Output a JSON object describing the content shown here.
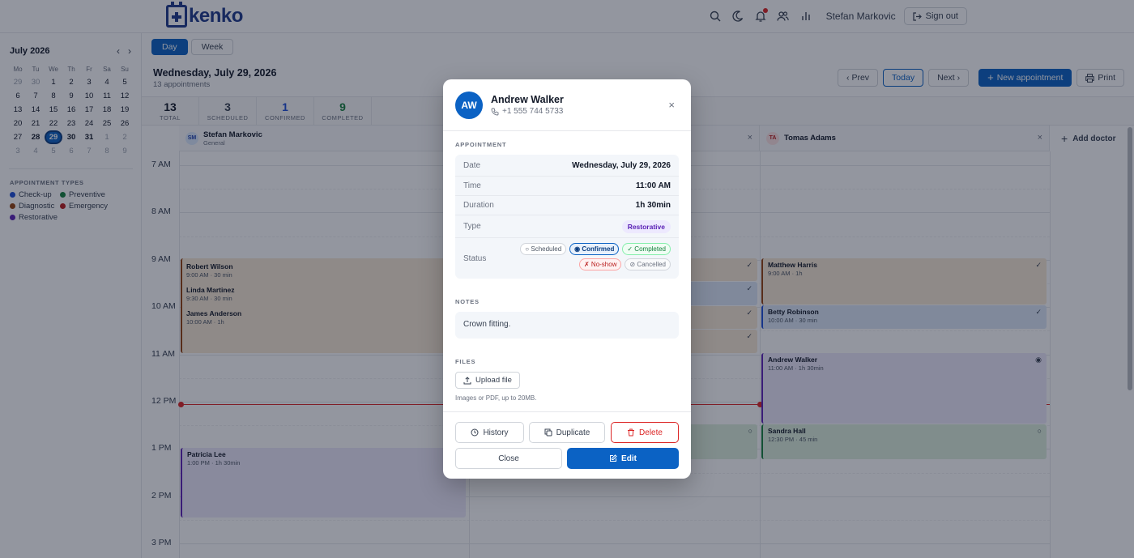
{
  "header": {
    "logo_text": "kenko",
    "user_name": "Stefan Markovic",
    "sign_out_label": "Sign out",
    "icons": [
      "search-icon",
      "moon-icon",
      "bell-icon",
      "users-icon",
      "chart-icon"
    ]
  },
  "sidebar": {
    "month_label": "July 2026",
    "weekdays": [
      "Mo",
      "Tu",
      "We",
      "Th",
      "Fr",
      "Sa",
      "Su"
    ],
    "types_title": "APPOINTMENT TYPES",
    "types": [
      {
        "label": "Check-up",
        "color": "#1d4ed8"
      },
      {
        "label": "Preventive",
        "color": "#15803d"
      },
      {
        "label": "Diagnostic",
        "color": "#92400e"
      },
      {
        "label": "Emergency",
        "color": "#b91c1c"
      },
      {
        "label": "Restorative",
        "color": "#5b21b6"
      }
    ]
  },
  "mini_calendar": [
    [
      "29",
      "30",
      "1",
      "2",
      "3",
      "4",
      "5"
    ],
    [
      "6",
      "7",
      "8",
      "9",
      "10",
      "11",
      "12"
    ],
    [
      "13",
      "14",
      "15",
      "16",
      "17",
      "18",
      "19"
    ],
    [
      "20",
      "21",
      "22",
      "23",
      "24",
      "25",
      "26"
    ],
    [
      "27",
      "28",
      "29",
      "30",
      "31",
      "1",
      "2"
    ],
    [
      "3",
      "4",
      "5",
      "6",
      "7",
      "8",
      "9"
    ]
  ],
  "view_tabs": {
    "day": "Day",
    "week": "Week"
  },
  "day": {
    "title": "Wednesday, July 29, 2026",
    "subtitle": "13 appointments",
    "prev_label": "‹ Prev",
    "today_label": "Today",
    "next_label": "Next ›",
    "new_label": "New appointment",
    "print_label": "Print"
  },
  "stats": [
    {
      "value": "13",
      "label": "TOTAL",
      "color": "#111827"
    },
    {
      "value": "3",
      "label": "SCHEDULED",
      "color": "#374151"
    },
    {
      "value": "1",
      "label": "CONFIRMED",
      "color": "#1d4ed8"
    },
    {
      "value": "9",
      "label": "COMPLETED",
      "color": "#15803d"
    }
  ],
  "doctors": [
    {
      "initials": "SM",
      "name": "Stefan Markovic",
      "specialty": "General"
    },
    {
      "initials": "TA",
      "name": "Tomas Adams",
      "specialty": ""
    }
  ],
  "add_doctor_label": "Add doctor",
  "hours": [
    "7 AM",
    "8 AM",
    "9 AM",
    "10 AM",
    "11 AM",
    "12 PM",
    "1 PM",
    "2 PM",
    "3 PM"
  ],
  "appointments": [
    {
      "name": "Robert Wilson",
      "time": "9:00 AM · 30 min"
    },
    {
      "name": "Linda Martinez",
      "time": "9:30 AM · 30 min"
    },
    {
      "name": "James Anderson",
      "time": "10:00 AM · 1h"
    },
    {
      "name": "Patricia Lee",
      "time": "1:00 PM · 1h 30min"
    },
    {
      "name": "Matthew Harris",
      "time": "9:00 AM · 1h",
      "status": "✓"
    },
    {
      "name": "Betty Robinson",
      "time": "10:00 AM · 30 min",
      "status": "✓"
    },
    {
      "name": "Andrew Walker",
      "time": "11:00 AM · 1h 30min",
      "status": "◉"
    },
    {
      "name": "Sandra Hall",
      "time": "12:30 PM · 45 min",
      "status": "○"
    }
  ],
  "middle_status_marks": [
    "✓",
    "✓",
    "✓",
    "✓",
    "○"
  ],
  "modal": {
    "initials": "AW",
    "patient_name": "Andrew Walker",
    "phone": "+1 555 744 5733",
    "appointment_section": "APPOINTMENT",
    "date_label": "Date",
    "date_value": "Wednesday, July 29, 2026",
    "time_label": "Time",
    "time_value": "11:00 AM",
    "duration_label": "Duration",
    "duration_value": "1h 30min",
    "type_label": "Type",
    "type_value": "Restorative",
    "status_label": "Status",
    "statuses": {
      "scheduled": "○ Scheduled",
      "confirmed": "◉ Confirmed",
      "completed": "✓ Completed",
      "noshow": "✗ No-show",
      "cancelled": "⊘ Cancelled"
    },
    "notes_section": "NOTES",
    "notes": "Crown fitting.",
    "files_section": "FILES",
    "upload_label": "Upload file",
    "upload_hint": "Images or PDF, up to 20MB.",
    "history_label": "History",
    "duplicate_label": "Duplicate",
    "delete_label": "Delete",
    "close_label": "Close",
    "edit_label": "Edit"
  }
}
